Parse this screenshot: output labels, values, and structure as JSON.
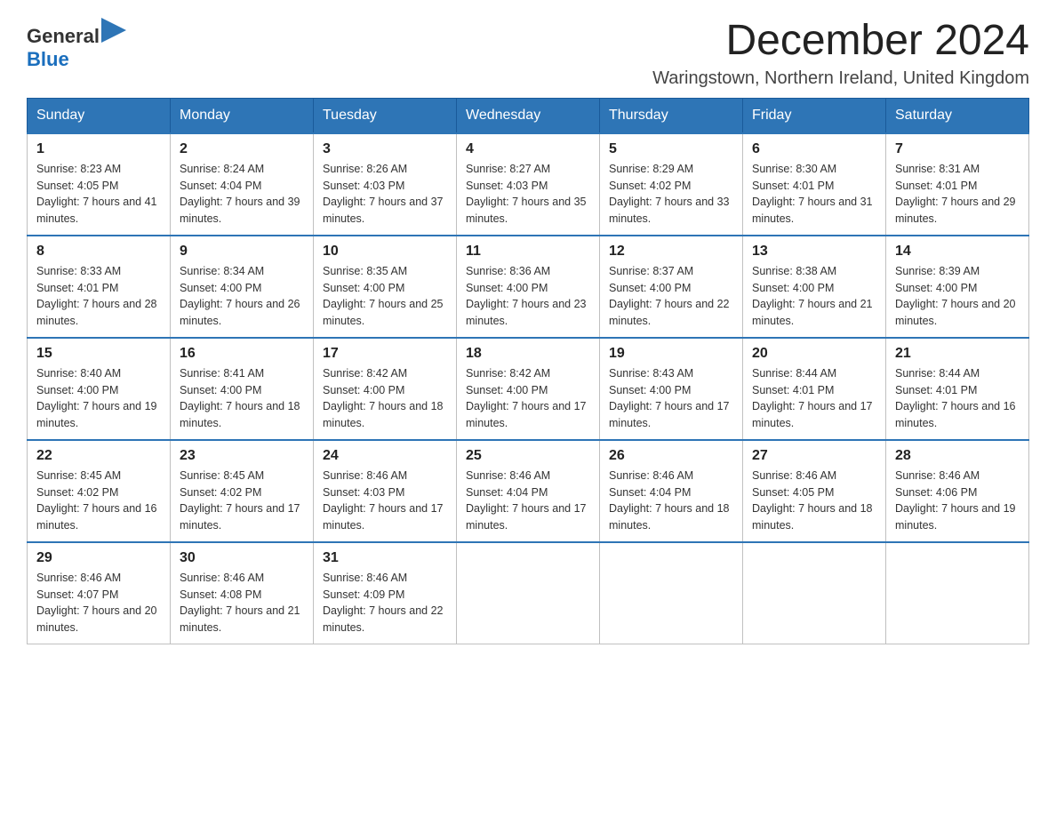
{
  "header": {
    "logo_general": "General",
    "logo_blue": "Blue",
    "title": "December 2024",
    "subtitle": "Waringstown, Northern Ireland, United Kingdom"
  },
  "days_of_week": [
    "Sunday",
    "Monday",
    "Tuesday",
    "Wednesday",
    "Thursday",
    "Friday",
    "Saturday"
  ],
  "weeks": [
    [
      {
        "day": "1",
        "sunrise": "8:23 AM",
        "sunset": "4:05 PM",
        "daylight": "7 hours and 41 minutes."
      },
      {
        "day": "2",
        "sunrise": "8:24 AM",
        "sunset": "4:04 PM",
        "daylight": "7 hours and 39 minutes."
      },
      {
        "day": "3",
        "sunrise": "8:26 AM",
        "sunset": "4:03 PM",
        "daylight": "7 hours and 37 minutes."
      },
      {
        "day": "4",
        "sunrise": "8:27 AM",
        "sunset": "4:03 PM",
        "daylight": "7 hours and 35 minutes."
      },
      {
        "day": "5",
        "sunrise": "8:29 AM",
        "sunset": "4:02 PM",
        "daylight": "7 hours and 33 minutes."
      },
      {
        "day": "6",
        "sunrise": "8:30 AM",
        "sunset": "4:01 PM",
        "daylight": "7 hours and 31 minutes."
      },
      {
        "day": "7",
        "sunrise": "8:31 AM",
        "sunset": "4:01 PM",
        "daylight": "7 hours and 29 minutes."
      }
    ],
    [
      {
        "day": "8",
        "sunrise": "8:33 AM",
        "sunset": "4:01 PM",
        "daylight": "7 hours and 28 minutes."
      },
      {
        "day": "9",
        "sunrise": "8:34 AM",
        "sunset": "4:00 PM",
        "daylight": "7 hours and 26 minutes."
      },
      {
        "day": "10",
        "sunrise": "8:35 AM",
        "sunset": "4:00 PM",
        "daylight": "7 hours and 25 minutes."
      },
      {
        "day": "11",
        "sunrise": "8:36 AM",
        "sunset": "4:00 PM",
        "daylight": "7 hours and 23 minutes."
      },
      {
        "day": "12",
        "sunrise": "8:37 AM",
        "sunset": "4:00 PM",
        "daylight": "7 hours and 22 minutes."
      },
      {
        "day": "13",
        "sunrise": "8:38 AM",
        "sunset": "4:00 PM",
        "daylight": "7 hours and 21 minutes."
      },
      {
        "day": "14",
        "sunrise": "8:39 AM",
        "sunset": "4:00 PM",
        "daylight": "7 hours and 20 minutes."
      }
    ],
    [
      {
        "day": "15",
        "sunrise": "8:40 AM",
        "sunset": "4:00 PM",
        "daylight": "7 hours and 19 minutes."
      },
      {
        "day": "16",
        "sunrise": "8:41 AM",
        "sunset": "4:00 PM",
        "daylight": "7 hours and 18 minutes."
      },
      {
        "day": "17",
        "sunrise": "8:42 AM",
        "sunset": "4:00 PM",
        "daylight": "7 hours and 18 minutes."
      },
      {
        "day": "18",
        "sunrise": "8:42 AM",
        "sunset": "4:00 PM",
        "daylight": "7 hours and 17 minutes."
      },
      {
        "day": "19",
        "sunrise": "8:43 AM",
        "sunset": "4:00 PM",
        "daylight": "7 hours and 17 minutes."
      },
      {
        "day": "20",
        "sunrise": "8:44 AM",
        "sunset": "4:01 PM",
        "daylight": "7 hours and 17 minutes."
      },
      {
        "day": "21",
        "sunrise": "8:44 AM",
        "sunset": "4:01 PM",
        "daylight": "7 hours and 16 minutes."
      }
    ],
    [
      {
        "day": "22",
        "sunrise": "8:45 AM",
        "sunset": "4:02 PM",
        "daylight": "7 hours and 16 minutes."
      },
      {
        "day": "23",
        "sunrise": "8:45 AM",
        "sunset": "4:02 PM",
        "daylight": "7 hours and 17 minutes."
      },
      {
        "day": "24",
        "sunrise": "8:46 AM",
        "sunset": "4:03 PM",
        "daylight": "7 hours and 17 minutes."
      },
      {
        "day": "25",
        "sunrise": "8:46 AM",
        "sunset": "4:04 PM",
        "daylight": "7 hours and 17 minutes."
      },
      {
        "day": "26",
        "sunrise": "8:46 AM",
        "sunset": "4:04 PM",
        "daylight": "7 hours and 18 minutes."
      },
      {
        "day": "27",
        "sunrise": "8:46 AM",
        "sunset": "4:05 PM",
        "daylight": "7 hours and 18 minutes."
      },
      {
        "day": "28",
        "sunrise": "8:46 AM",
        "sunset": "4:06 PM",
        "daylight": "7 hours and 19 minutes."
      }
    ],
    [
      {
        "day": "29",
        "sunrise": "8:46 AM",
        "sunset": "4:07 PM",
        "daylight": "7 hours and 20 minutes."
      },
      {
        "day": "30",
        "sunrise": "8:46 AM",
        "sunset": "4:08 PM",
        "daylight": "7 hours and 21 minutes."
      },
      {
        "day": "31",
        "sunrise": "8:46 AM",
        "sunset": "4:09 PM",
        "daylight": "7 hours and 22 minutes."
      },
      null,
      null,
      null,
      null
    ]
  ]
}
